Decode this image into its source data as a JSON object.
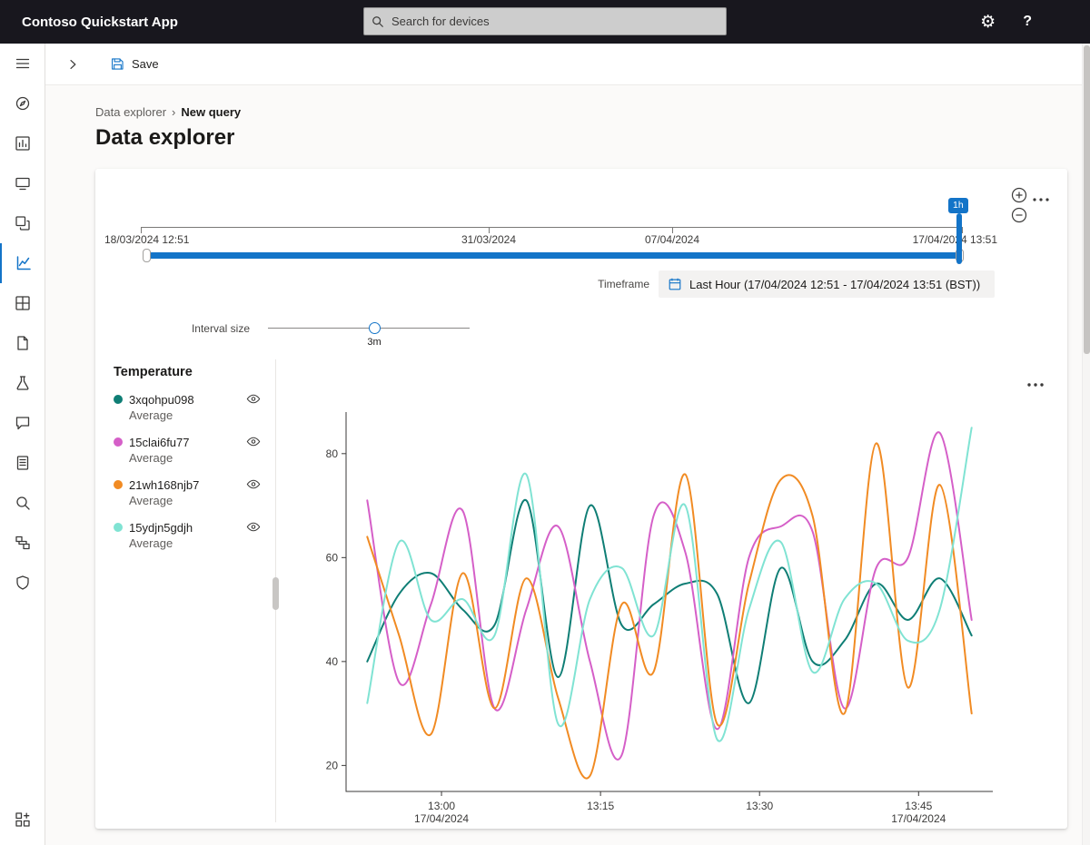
{
  "colors": {
    "accent": "#1374c8",
    "teal": "#0f7e75",
    "magenta": "#d55fc8",
    "orange": "#f18b23",
    "cyan": "#80e3d3"
  },
  "topbar": {
    "app_title": "Contoso Quickstart App",
    "search_placeholder": "Search for devices",
    "gear_glyph": "⚙",
    "help_glyph": "?"
  },
  "sidebar": {
    "items": [
      {
        "icon": "menu"
      },
      {
        "icon": "overview"
      },
      {
        "icon": "dashboards"
      },
      {
        "icon": "devices"
      },
      {
        "icon": "device-groups"
      },
      {
        "icon": "data-explorer",
        "selected": true
      },
      {
        "icon": "entities"
      },
      {
        "icon": "jobs"
      },
      {
        "icon": "rules"
      },
      {
        "icon": "deployments"
      },
      {
        "icon": "audit-logs"
      },
      {
        "icon": "diagnostics"
      },
      {
        "icon": "edge"
      },
      {
        "icon": "security"
      },
      {
        "icon": "app-settings",
        "bottom": true
      }
    ]
  },
  "command_bar": {
    "save_label": "Save"
  },
  "breadcrumb": {
    "root": "Data explorer",
    "separator": "›",
    "current": "New query"
  },
  "page": {
    "title": "Data explorer"
  },
  "timeline": {
    "start_label": "18/03/2024 12:51",
    "mid1_label": "31/03/2024",
    "mid2_label": "07/04/2024",
    "end_label": "17/04/2024 13:51",
    "range_badge": "1h"
  },
  "timeframe": {
    "label": "Timeframe",
    "value": "Last Hour (17/04/2024 12:51 - 17/04/2024 13:51 (BST))"
  },
  "interval": {
    "label": "Interval size",
    "value": "3m"
  },
  "legend": {
    "title": "Temperature",
    "items": [
      {
        "name": "3xqohpu098",
        "agg": "Average",
        "color": "#0f7e75"
      },
      {
        "name": "15clai6fu77",
        "agg": "Average",
        "color": "#d55fc8"
      },
      {
        "name": "21wh168njb7",
        "agg": "Average",
        "color": "#f18b23"
      },
      {
        "name": "15ydjn5gdjh",
        "agg": "Average",
        "color": "#80e3d3"
      }
    ]
  },
  "chart_data": {
    "type": "line",
    "title": "Temperature",
    "x_unit": "minutes after 17/04/2024 12:51",
    "x": [
      2,
      5,
      8,
      11,
      14,
      17,
      20,
      23,
      26,
      29,
      32,
      35,
      38,
      41,
      44,
      47,
      50,
      53,
      56,
      59
    ],
    "series": [
      {
        "name": "3xqohpu098 Average",
        "color": "#0f7e75",
        "values": [
          40,
          53,
          57,
          50,
          47,
          71,
          37,
          70,
          47,
          51,
          55,
          53,
          32,
          58,
          40,
          44,
          55,
          48,
          56,
          45
        ]
      },
      {
        "name": "15clai6fu77 Average",
        "color": "#d55fc8",
        "values": [
          71,
          36,
          51,
          69,
          31,
          50,
          66,
          40,
          22,
          68,
          61,
          27,
          60,
          66,
          65,
          31,
          58,
          60,
          84,
          48
        ]
      },
      {
        "name": "21wh168njb7 Average",
        "color": "#f18b23",
        "values": [
          64,
          45,
          26,
          57,
          31,
          56,
          33,
          18,
          51,
          38,
          76,
          28,
          55,
          75,
          68,
          30,
          82,
          35,
          74,
          30
        ]
      },
      {
        "name": "15ydjn5gdjh Average",
        "color": "#80e3d3",
        "values": [
          32,
          63,
          48,
          52,
          45,
          76,
          28,
          52,
          58,
          45,
          70,
          25,
          50,
          63,
          38,
          52,
          55,
          44,
          50,
          85
        ]
      }
    ],
    "xlim": [
      0,
      61
    ],
    "ylim": [
      15,
      88
    ],
    "y_ticks": [
      20,
      40,
      60,
      80
    ],
    "x_ticks": [
      {
        "min": 9,
        "label": "13:00",
        "sub": "17/04/2024"
      },
      {
        "min": 24,
        "label": "13:15"
      },
      {
        "min": 39,
        "label": "13:30"
      },
      {
        "min": 54,
        "label": "13:45",
        "sub": "17/04/2024"
      }
    ],
    "grid": false,
    "legend_position": "left"
  }
}
